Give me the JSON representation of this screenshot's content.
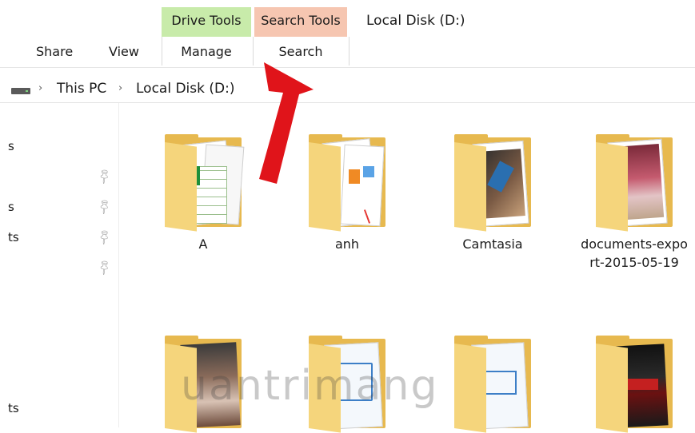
{
  "window_title": "Local Disk (D:)",
  "ribbon": {
    "contextual": {
      "drive_tools": "Drive Tools",
      "search_tools": "Search Tools"
    },
    "tabs": {
      "share": "Share",
      "view": "View",
      "manage": "Manage",
      "search": "Search"
    }
  },
  "address": {
    "crumbs": [
      "This PC",
      "Local Disk (D:)"
    ],
    "icon": "drive-icon"
  },
  "nav": {
    "fragments": [
      "s",
      "s",
      "ts",
      "ts"
    ]
  },
  "items": [
    {
      "name": "A"
    },
    {
      "name": "anh"
    },
    {
      "name": "Camtasia"
    },
    {
      "name_line1": "documents-expo",
      "name_line2": "rt-2015-05-19"
    }
  ],
  "watermark": "uantrimang",
  "colors": {
    "drive_tools_bg": "#c8ebaa",
    "search_tools_bg": "#f6c6b1",
    "folder": "#f5d57c",
    "arrow": "#e0141a"
  }
}
